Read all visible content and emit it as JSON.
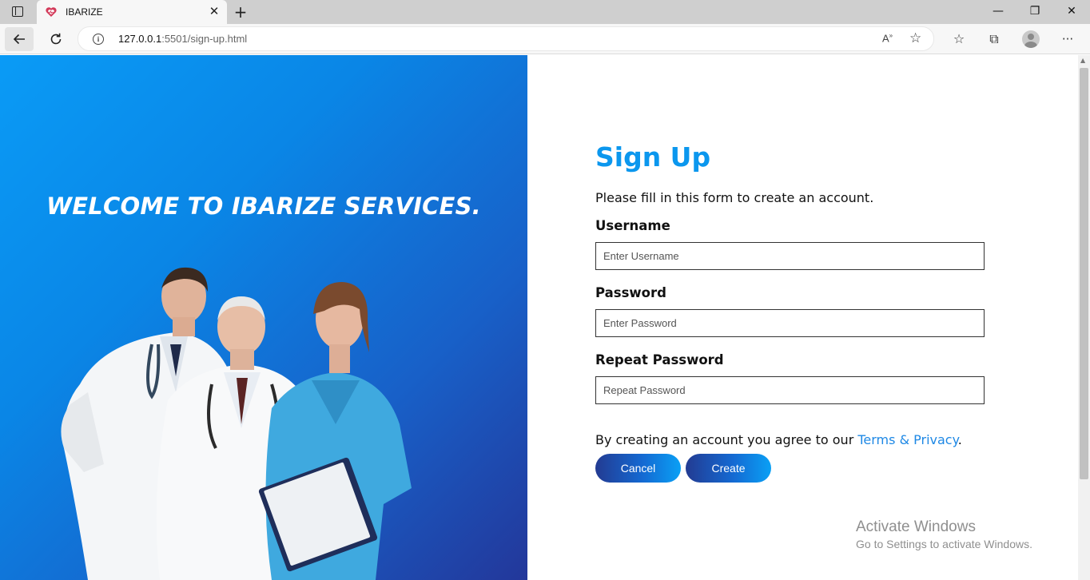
{
  "browser": {
    "tab_title": "IBARIZE",
    "url_host": "127.0.0.1",
    "url_rest": ":5501/sign-up.html",
    "new_tab_label": "+",
    "close_tab_label": "✕",
    "window_controls": {
      "minimize": "—",
      "maximize": "❐",
      "close": "✕"
    },
    "read_aloud_label": "Â",
    "favicon_color": "#d33a5a"
  },
  "left": {
    "welcome_text": "WELCOME TO IBARIZE SERVICES.",
    "gradient_colors": [
      "#0a9bf6",
      "#23379a"
    ]
  },
  "form": {
    "title": "Sign Up",
    "subtitle": "Please fill in this form to create an account.",
    "username": {
      "label": "Username",
      "placeholder": "Enter Username",
      "value": ""
    },
    "password": {
      "label": "Password",
      "placeholder": "Enter Password",
      "value": ""
    },
    "repeat_password": {
      "label": "Repeat Password",
      "placeholder": "Repeat Password",
      "value": ""
    },
    "agree_text": "By creating an account you agree to our ",
    "terms_link": "Terms & Privacy",
    "agree_end": ".",
    "cancel_label": "Cancel",
    "create_label": "Create",
    "accent_color": "#0b97ee"
  },
  "watermark": {
    "line1": "Activate Windows",
    "line2": "Go to Settings to activate Windows."
  }
}
